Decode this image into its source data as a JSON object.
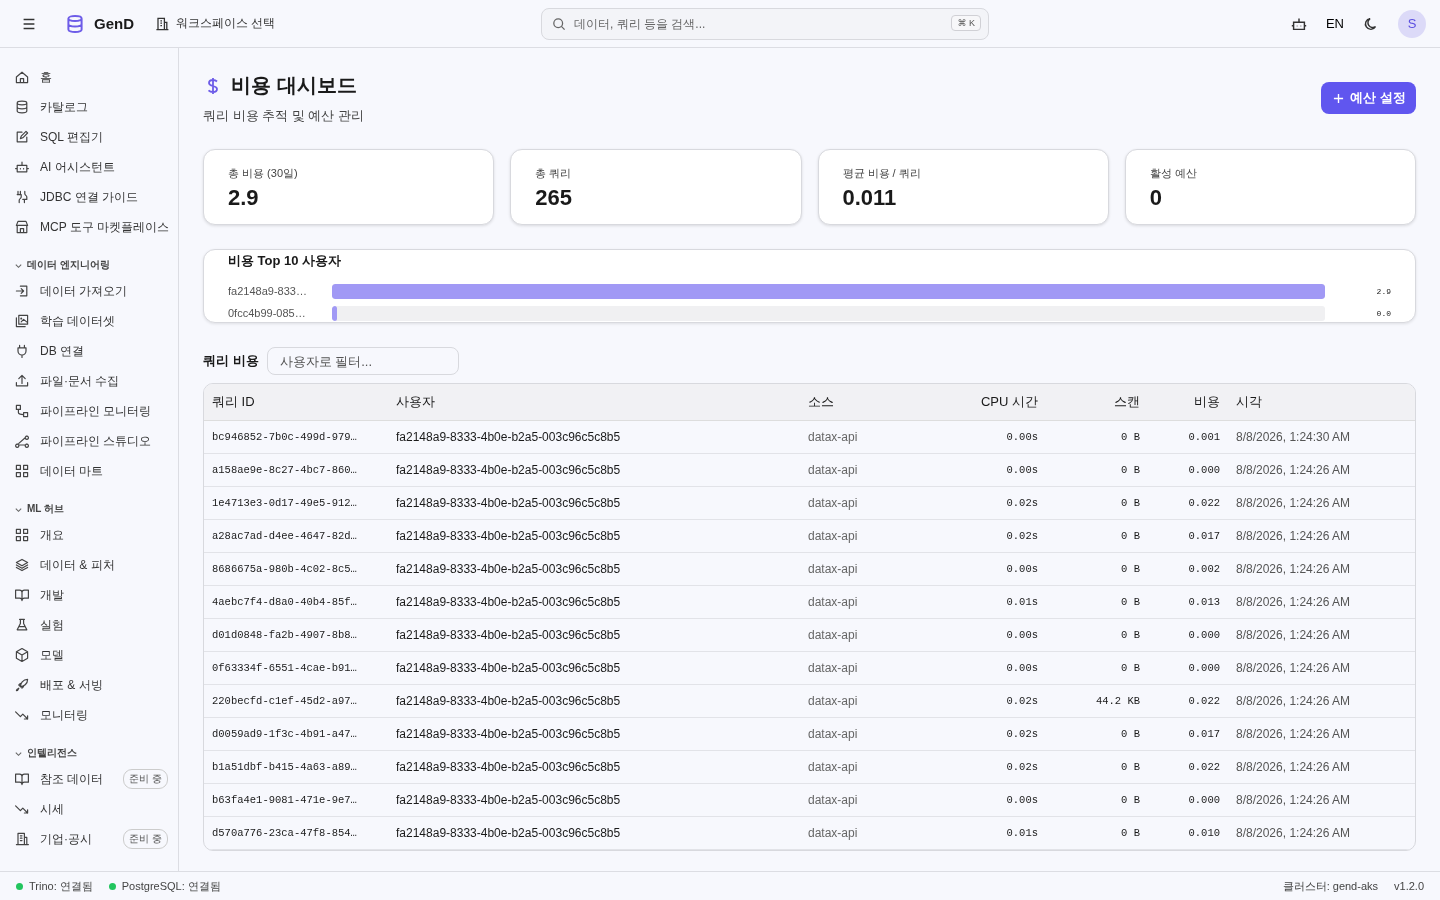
{
  "topbar": {
    "brand": "GenD",
    "workspace": "워크스페이스 선택",
    "search": {
      "placeholder": "데이터, 쿼리 등을 검색...",
      "shortcut": "⌘ K"
    },
    "language": "EN",
    "avatar": "S"
  },
  "sidebar": {
    "groups": [
      {
        "items": [
          {
            "label": "홈"
          },
          {
            "label": "카탈로그"
          },
          {
            "label": "SQL 편집기"
          },
          {
            "label": "AI 어시스턴트"
          },
          {
            "label": "JDBC 연결 가이드"
          },
          {
            "label": "MCP 도구 마켓플레이스"
          }
        ]
      },
      {
        "title": "데이터 엔지니어링",
        "expanded": true,
        "items": [
          {
            "label": "데이터 가져오기"
          },
          {
            "label": "학습 데이터셋"
          },
          {
            "label": "DB 연결"
          },
          {
            "label": "파일·문서 수집"
          },
          {
            "label": "파이프라인 모니터링"
          },
          {
            "label": "파이프라인 스튜디오"
          },
          {
            "label": "데이터 마트"
          }
        ]
      },
      {
        "title": "ML 허브",
        "expanded": true,
        "items": [
          {
            "label": "개요"
          },
          {
            "label": "데이터 & 피처"
          },
          {
            "label": "개발"
          },
          {
            "label": "실험"
          },
          {
            "label": "모델"
          },
          {
            "label": "배포 & 서빙"
          },
          {
            "label": "모니터링"
          }
        ]
      },
      {
        "title": "인텔리전스",
        "expanded": true,
        "items": [
          {
            "label": "참조 데이터",
            "badge": "준비 중"
          },
          {
            "label": "시세"
          },
          {
            "label": "기업·공시",
            "badge": "준비 중"
          }
        ]
      }
    ]
  },
  "page": {
    "title": "비용 대시보드",
    "subtitle": "쿼리 비용 추적 및 예산 관리",
    "action": "예산 설정"
  },
  "stats": [
    {
      "label": "총 비용 (30일)",
      "value": "2.9"
    },
    {
      "label": "총 쿼리",
      "value": "265"
    },
    {
      "label": "평균 비용 / 쿼리",
      "value": "0.011"
    },
    {
      "label": "활성 예산",
      "value": "0"
    }
  ],
  "top_users": {
    "title": "비용 Top 10 사용자",
    "items": [
      {
        "name": "fa2148a9-833…",
        "level": 1.0,
        "reading": "2.9"
      },
      {
        "name": "0fcc4b99-085…",
        "level": 0.005,
        "reading": "0.0"
      }
    ]
  },
  "query_costs": {
    "title": "쿼리 비용",
    "filter": {
      "placeholder": "사용자로 필터..."
    },
    "columns": [
      "쿼리 ID",
      "사용자",
      "소스",
      "CPU 시간",
      "스캔",
      "비용",
      "시각"
    ],
    "rows": [
      [
        "bc946852-7b0c-499d-979…",
        "fa2148a9-8333-4b0e-b2a5-003c96c5c8b5",
        "datax-api",
        "0.00s",
        "0 B",
        "0.001",
        "8/8/2026, 1:24:30 AM"
      ],
      [
        "a158ae9e-8c27-4bc7-860…",
        "fa2148a9-8333-4b0e-b2a5-003c96c5c8b5",
        "datax-api",
        "0.00s",
        "0 B",
        "0.000",
        "8/8/2026, 1:24:26 AM"
      ],
      [
        "1e4713e3-0d17-49e5-912…",
        "fa2148a9-8333-4b0e-b2a5-003c96c5c8b5",
        "datax-api",
        "0.02s",
        "0 B",
        "0.022",
        "8/8/2026, 1:24:26 AM"
      ],
      [
        "a28ac7ad-d4ee-4647-82d…",
        "fa2148a9-8333-4b0e-b2a5-003c96c5c8b5",
        "datax-api",
        "0.02s",
        "0 B",
        "0.017",
        "8/8/2026, 1:24:26 AM"
      ],
      [
        "8686675a-980b-4c02-8c5…",
        "fa2148a9-8333-4b0e-b2a5-003c96c5c8b5",
        "datax-api",
        "0.00s",
        "0 B",
        "0.002",
        "8/8/2026, 1:24:26 AM"
      ],
      [
        "4aebc7f4-d8a0-40b4-85f…",
        "fa2148a9-8333-4b0e-b2a5-003c96c5c8b5",
        "datax-api",
        "0.01s",
        "0 B",
        "0.013",
        "8/8/2026, 1:24:26 AM"
      ],
      [
        "d01d0848-fa2b-4907-8b8…",
        "fa2148a9-8333-4b0e-b2a5-003c96c5c8b5",
        "datax-api",
        "0.00s",
        "0 B",
        "0.000",
        "8/8/2026, 1:24:26 AM"
      ],
      [
        "0f63334f-6551-4cae-b91…",
        "fa2148a9-8333-4b0e-b2a5-003c96c5c8b5",
        "datax-api",
        "0.00s",
        "0 B",
        "0.000",
        "8/8/2026, 1:24:26 AM"
      ],
      [
        "220becfd-c1ef-45d2-a97…",
        "fa2148a9-8333-4b0e-b2a5-003c96c5c8b5",
        "datax-api",
        "0.02s",
        "44.2 KB",
        "0.022",
        "8/8/2026, 1:24:26 AM"
      ],
      [
        "d0059ad9-1f3c-4b91-a47…",
        "fa2148a9-8333-4b0e-b2a5-003c96c5c8b5",
        "datax-api",
        "0.02s",
        "0 B",
        "0.017",
        "8/8/2026, 1:24:26 AM"
      ],
      [
        "b1a51dbf-b415-4a63-a89…",
        "fa2148a9-8333-4b0e-b2a5-003c96c5c8b5",
        "datax-api",
        "0.02s",
        "0 B",
        "0.022",
        "8/8/2026, 1:24:26 AM"
      ],
      [
        "b63fa4e1-9081-471e-9e7…",
        "fa2148a9-8333-4b0e-b2a5-003c96c5c8b5",
        "datax-api",
        "0.00s",
        "0 B",
        "0.000",
        "8/8/2026, 1:24:26 AM"
      ],
      [
        "d570a776-23ca-47f8-854…",
        "fa2148a9-8333-4b0e-b2a5-003c96c5c8b5",
        "datax-api",
        "0.01s",
        "0 B",
        "0.010",
        "8/8/2026, 1:24:26 AM"
      ]
    ]
  },
  "status_bar": {
    "connections": [
      {
        "label": "Trino: 연결됨",
        "color": "#22c55e"
      },
      {
        "label": "PostgreSQL: 연결됨",
        "color": "#22c55e"
      }
    ],
    "cluster": "클러스터: gend-aks",
    "version": "v1.2.0"
  }
}
